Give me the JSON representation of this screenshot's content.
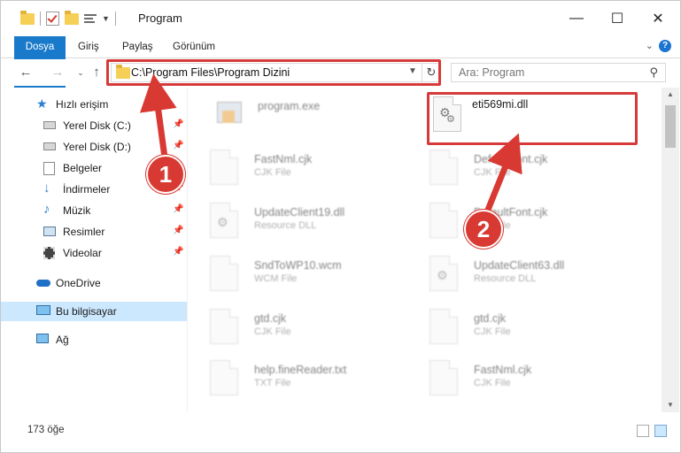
{
  "window": {
    "title": "Program"
  },
  "ribbon": {
    "tabs": [
      "Dosya",
      "Giriş",
      "Paylaş",
      "Görünüm"
    ]
  },
  "nav": {
    "address": "C:\\Program Files\\Program Dizini",
    "search_placeholder": "Ara: Program"
  },
  "sidebar": {
    "items": [
      {
        "label": "Hızlı erişim",
        "icon": "star-icon"
      },
      {
        "label": "Yerel Disk (C:)",
        "icon": "drive-icon",
        "pinned": true
      },
      {
        "label": "Yerel Disk (D:)",
        "icon": "drive-icon",
        "pinned": true
      },
      {
        "label": "Belgeler",
        "icon": "documents-icon",
        "pinned": true
      },
      {
        "label": "İndirmeler",
        "icon": "download-icon",
        "pinned": true
      },
      {
        "label": "Müzik",
        "icon": "music-icon",
        "pinned": true
      },
      {
        "label": "Resimler",
        "icon": "pictures-icon",
        "pinned": true
      },
      {
        "label": "Videolar",
        "icon": "videos-icon",
        "pinned": true
      },
      {
        "label": "OneDrive",
        "icon": "onedrive-icon"
      },
      {
        "label": "Bu bilgisayar",
        "icon": "computer-icon",
        "selected": true
      },
      {
        "label": "Ağ",
        "icon": "network-icon"
      }
    ]
  },
  "files": [
    {
      "name": "program.exe",
      "type": ""
    },
    {
      "name": "eti569mi.dll",
      "type": ""
    },
    {
      "name": "FastNml.cjk",
      "type": "CJK File"
    },
    {
      "name": "DefaultFont.cjk",
      "type": "CJK File"
    },
    {
      "name": "UpdateClient19.dll",
      "type": "Resource DLL"
    },
    {
      "name": "DefaultFont.cjk",
      "type": "CJK File"
    },
    {
      "name": "SndToWP10.wcm",
      "type": "WCM File"
    },
    {
      "name": "UpdateClient63.dll",
      "type": "Resource DLL"
    },
    {
      "name": "gtd.cjk",
      "type": "CJK File"
    },
    {
      "name": "gtd.cjk",
      "type": "CJK File"
    },
    {
      "name": "help.fineReader.txt",
      "type": "TXT File"
    },
    {
      "name": "FastNml.cjk",
      "type": "CJK File"
    }
  ],
  "status": {
    "item_count": "173 öğe"
  },
  "annotations": {
    "badge1": "1",
    "badge2": "2",
    "accent": "#d83a33"
  }
}
